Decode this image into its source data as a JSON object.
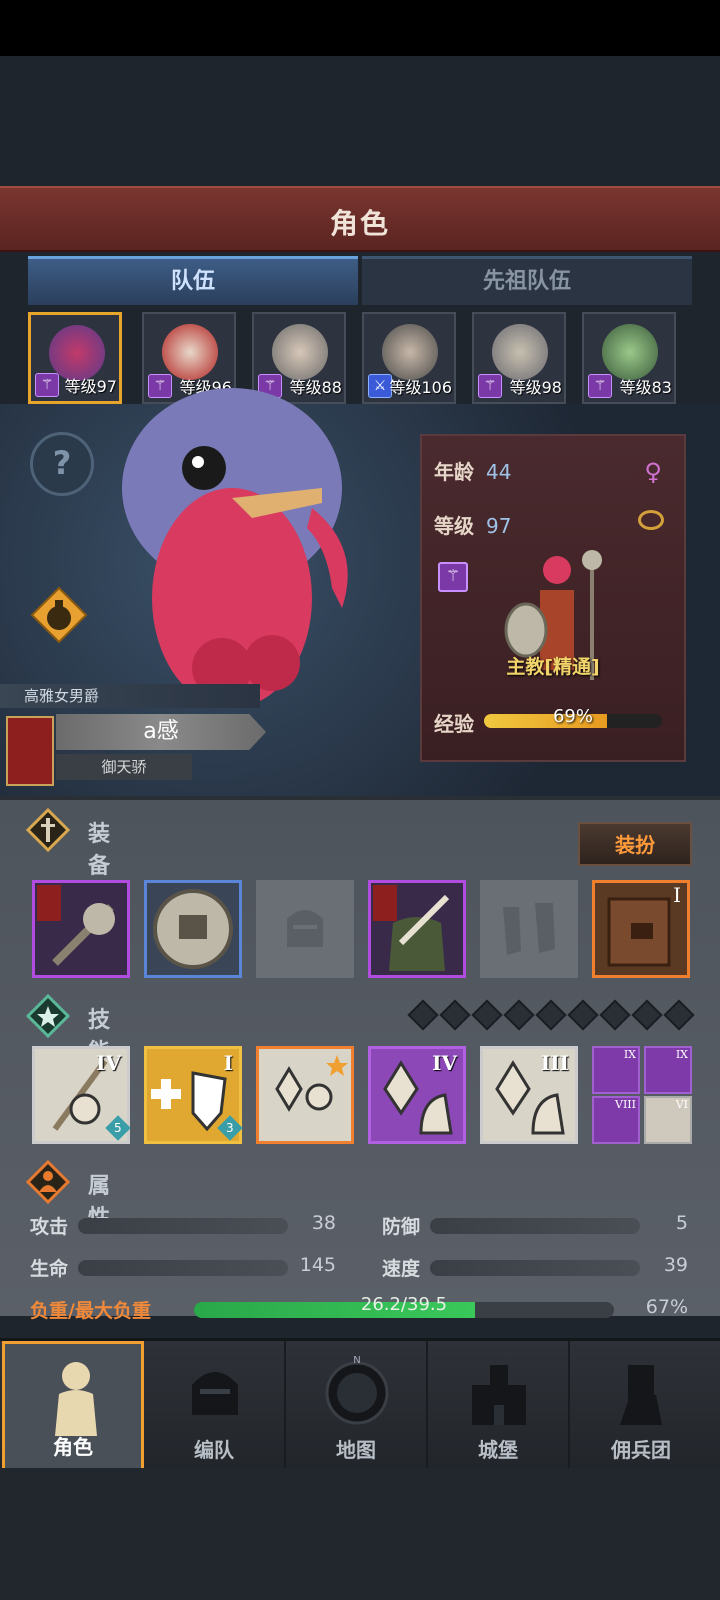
{
  "header": {
    "title": "角色"
  },
  "tabs": [
    {
      "label": "队伍"
    },
    {
      "label": "先祖队伍"
    }
  ],
  "party": [
    {
      "level": "等级97",
      "icon": "staff-icon"
    },
    {
      "level": "等级96",
      "icon": "staff-icon"
    },
    {
      "level": "等级88",
      "icon": "staff-icon"
    },
    {
      "level": "等级106",
      "icon": "sword-icon"
    },
    {
      "level": "等级98",
      "icon": "staff-icon"
    },
    {
      "level": "等级83",
      "icon": "staff-icon"
    }
  ],
  "hero": {
    "title": "高雅女男爵",
    "name": "a感",
    "guild": "御天骄",
    "age_label": "年龄",
    "age": "44",
    "level_label": "等级",
    "level": "97",
    "class_name": "主教[精通]",
    "exp_label": "经验",
    "exp_text": "69%",
    "exp_fraction": 0.69
  },
  "equipment": {
    "title": "装备",
    "dress_button": "装扮",
    "slots": [
      {
        "rarity": "purple",
        "icon": "mace-icon"
      },
      {
        "rarity": "blue",
        "icon": "shield-icon"
      },
      {
        "rarity": "empty",
        "icon": "helmet-icon"
      },
      {
        "rarity": "purple",
        "icon": "armor-icon"
      },
      {
        "rarity": "empty",
        "icon": "boots-icon"
      },
      {
        "rarity": "orange",
        "icon": "book-icon",
        "tier": "I"
      }
    ]
  },
  "skills": {
    "title": "技能",
    "list": [
      {
        "rarity": "white",
        "tier": "IV",
        "count": "5"
      },
      {
        "rarity": "gold",
        "tier": "I",
        "count": "3"
      },
      {
        "rarity": "orange",
        "tier": ""
      },
      {
        "rarity": "purple",
        "tier": "IV"
      },
      {
        "rarity": "white",
        "tier": "III"
      }
    ],
    "mini": [
      {
        "tier": "IX"
      },
      {
        "tier": "IX"
      },
      {
        "tier": "VIII"
      },
      {
        "tier": "VI"
      }
    ]
  },
  "attributes": {
    "title": "属性",
    "attack_label": "攻击",
    "attack": "38",
    "defense_label": "防御",
    "defense": "5",
    "hp_label": "生命",
    "hp": "145",
    "speed_label": "速度",
    "speed": "39",
    "load_label": "负重/最大负重",
    "load_text": "26.2/39.5",
    "load_pct": "67%",
    "load_fraction": 0.67
  },
  "nav": [
    {
      "label": "角色"
    },
    {
      "label": "编队"
    },
    {
      "label": "地图"
    },
    {
      "label": "城堡"
    },
    {
      "label": "佣兵团"
    }
  ]
}
